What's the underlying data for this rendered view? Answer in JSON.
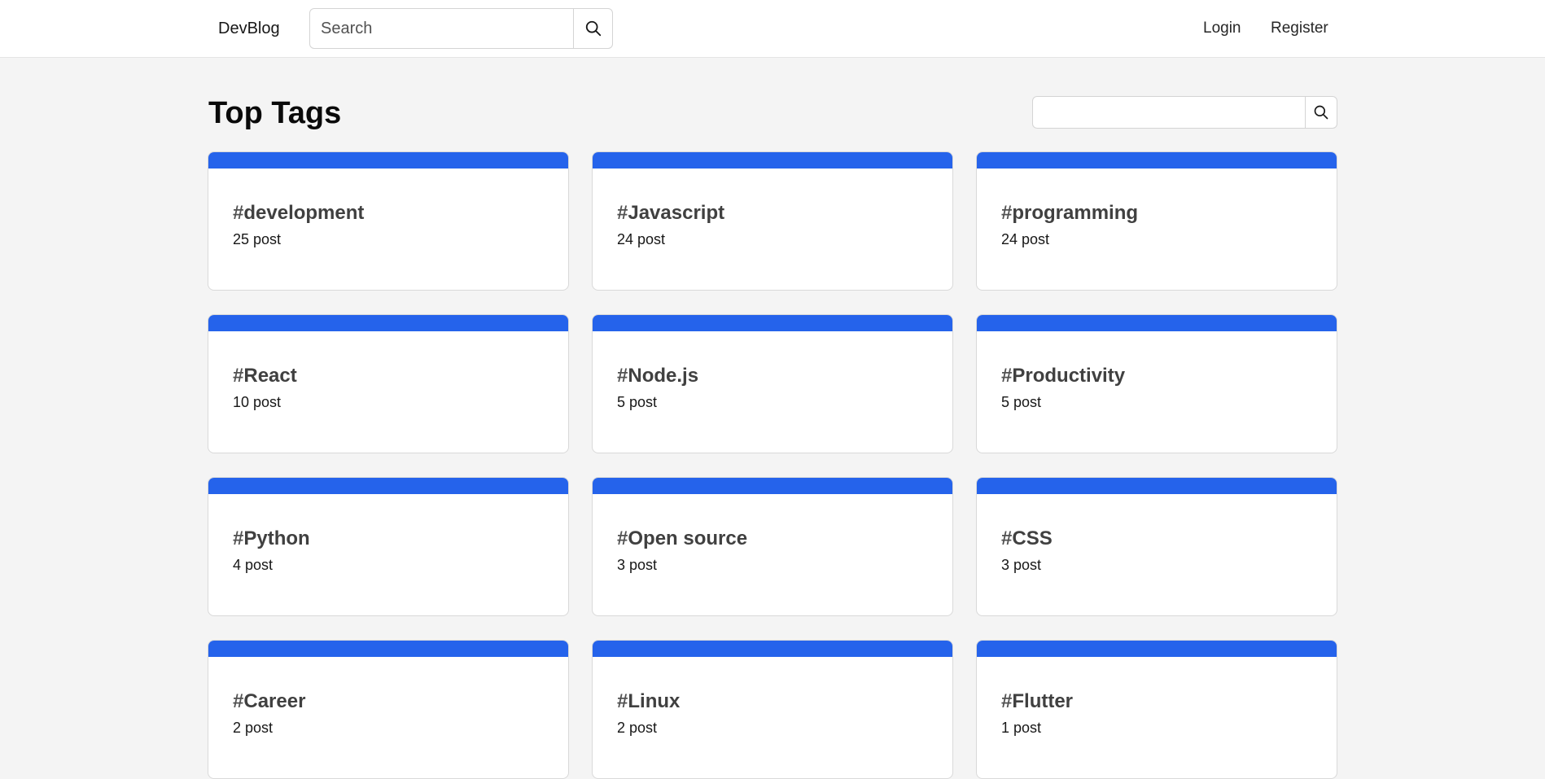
{
  "nav": {
    "brand": "DevBlog",
    "search_placeholder": "Search",
    "login": "Login",
    "register": "Register"
  },
  "main": {
    "title": "Top Tags",
    "tag_search_value": ""
  },
  "icons": {
    "search": "search-icon"
  },
  "colors": {
    "accent": "#2563eb",
    "page_bg": "#f4f4f4"
  },
  "tags": [
    {
      "hash": "#",
      "name": "development",
      "count": "25 post"
    },
    {
      "hash": "#",
      "name": "Javascript",
      "count": "24 post"
    },
    {
      "hash": "#",
      "name": "programming",
      "count": "24 post"
    },
    {
      "hash": "#",
      "name": "React",
      "count": "10 post"
    },
    {
      "hash": "#",
      "name": "Node.js",
      "count": "5 post"
    },
    {
      "hash": "#",
      "name": "Productivity",
      "count": "5 post"
    },
    {
      "hash": "#",
      "name": "Python",
      "count": "4 post"
    },
    {
      "hash": "#",
      "name": "Open source",
      "count": "3 post"
    },
    {
      "hash": "#",
      "name": "CSS",
      "count": "3 post"
    },
    {
      "hash": "#",
      "name": "Career",
      "count": "2 post"
    },
    {
      "hash": "#",
      "name": "Linux",
      "count": "2 post"
    },
    {
      "hash": "#",
      "name": "Flutter",
      "count": "1 post"
    }
  ]
}
